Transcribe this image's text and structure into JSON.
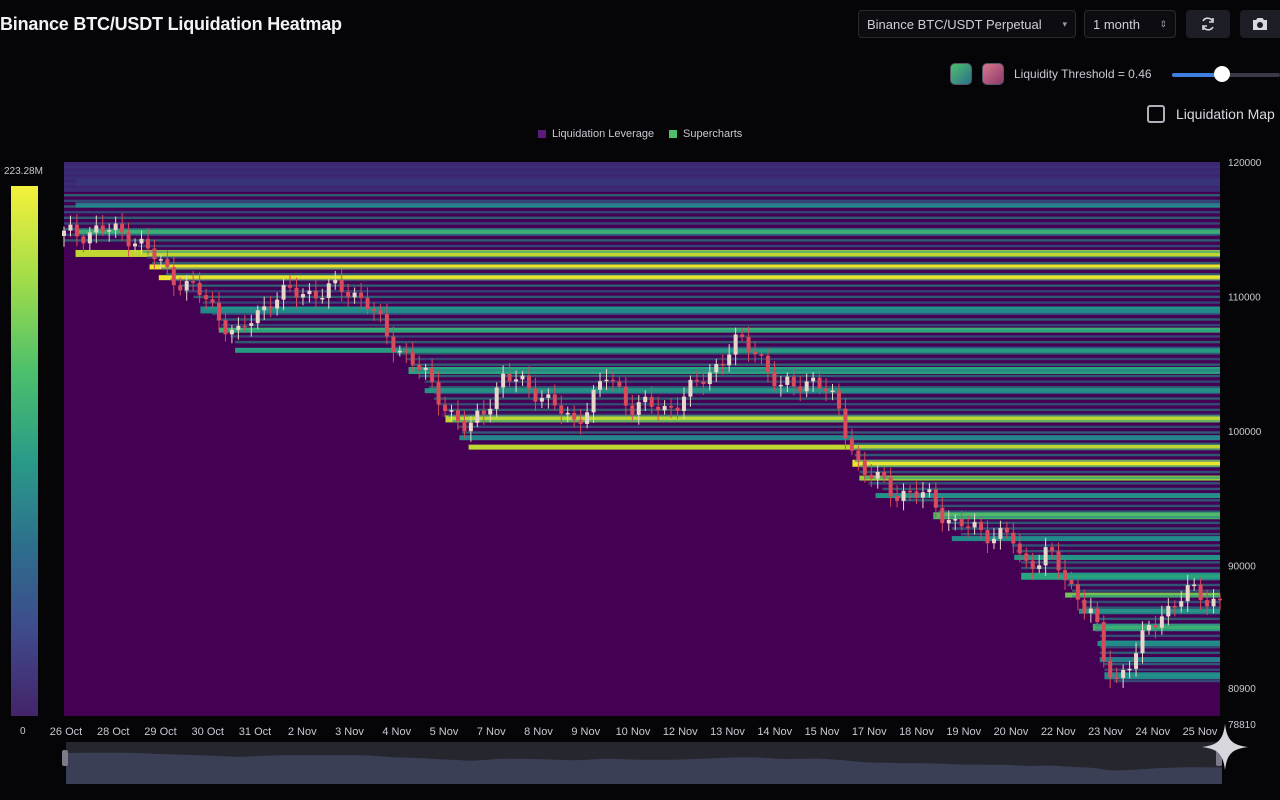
{
  "header": {
    "title": "Binance BTC/USDT Liquidation Heatmap",
    "pair_select": "Binance BTC/USDT Perpetual",
    "timeframe_select": "1 month",
    "refresh_icon": "refresh-icon",
    "camera_icon": "camera-icon"
  },
  "controls": {
    "threshold_label": "Liquidity Threshold = 0.46",
    "threshold_value": 0.46,
    "swatch_green": "#4cc06c",
    "swatch_pink": "#d9788e",
    "liquidation_map_label": "Liquidation Map",
    "liquidation_map_checked": false
  },
  "colors": {
    "background": "#050508",
    "heatmap_base": "#440154",
    "accent_blue": "#3d7ee0",
    "candle_up": "#e8d7c8",
    "candle_down": "#d94a5a"
  },
  "colorbar": {
    "max_label": "223.28M",
    "min_label": "0"
  },
  "chart_data": {
    "type": "heatmap",
    "title": "",
    "legend": [
      {
        "name": "Liquidation Leverage",
        "color": "#5a1b7a"
      },
      {
        "name": "Supercharts",
        "color": "#4cc06c"
      }
    ],
    "legend_position": "top-center",
    "y_axis": {
      "ticks": [
        "120000",
        "110000",
        "100000",
        "90000",
        "80900",
        "78810"
      ],
      "range": [
        78810,
        120000
      ]
    },
    "x_axis": {
      "ticks": [
        "26 Oct",
        "28 Oct",
        "29 Oct",
        "30 Oct",
        "31 Oct",
        "2 Nov",
        "3 Nov",
        "4 Nov",
        "5 Nov",
        "7 Nov",
        "8 Nov",
        "9 Nov",
        "10 Nov",
        "12 Nov",
        "13 Nov",
        "14 Nov",
        "15 Nov",
        "17 Nov",
        "18 Nov",
        "19 Nov",
        "20 Nov",
        "22 Nov",
        "23 Nov",
        "24 Nov",
        "25 Nov"
      ]
    },
    "price_path": [
      [
        0,
        114500
      ],
      [
        0.03,
        115000
      ],
      [
        0.06,
        114500
      ],
      [
        0.09,
        111800
      ],
      [
        0.12,
        110000
      ],
      [
        0.15,
        107000
      ],
      [
        0.18,
        110000
      ],
      [
        0.21,
        110300
      ],
      [
        0.24,
        110500
      ],
      [
        0.26,
        110000
      ],
      [
        0.28,
        106800
      ],
      [
        0.3,
        105500
      ],
      [
        0.32,
        103000
      ],
      [
        0.35,
        99800
      ],
      [
        0.38,
        104000
      ],
      [
        0.41,
        103000
      ],
      [
        0.44,
        100500
      ],
      [
        0.47,
        104000
      ],
      [
        0.49,
        102000
      ],
      [
        0.52,
        101600
      ],
      [
        0.55,
        103500
      ],
      [
        0.58,
        106500
      ],
      [
        0.6,
        106000
      ],
      [
        0.62,
        103000
      ],
      [
        0.65,
        104000
      ],
      [
        0.67,
        101500
      ],
      [
        0.69,
        97000
      ],
      [
        0.72,
        95500
      ],
      [
        0.75,
        95000
      ],
      [
        0.77,
        93000
      ],
      [
        0.8,
        92500
      ],
      [
        0.82,
        92000
      ],
      [
        0.83,
        90000
      ],
      [
        0.85,
        91000
      ],
      [
        0.87,
        88500
      ],
      [
        0.89,
        86500
      ],
      [
        0.9,
        82500
      ],
      [
        0.91,
        81500
      ],
      [
        0.93,
        84000
      ],
      [
        0.95,
        86500
      ],
      [
        0.97,
        88000
      ],
      [
        0.99,
        87500
      ],
      [
        1.0,
        87500
      ]
    ],
    "bands": [
      {
        "price": 118500,
        "intensity": 0.55
      },
      {
        "price": 116800,
        "intensity": 0.45
      },
      {
        "price": 114800,
        "intensity": 0.75
      },
      {
        "price": 113200,
        "intensity": 0.95
      },
      {
        "price": 112200,
        "intensity": 1.0
      },
      {
        "price": 111400,
        "intensity": 1.0
      },
      {
        "price": 109000,
        "intensity": 0.55
      },
      {
        "price": 107500,
        "intensity": 0.75
      },
      {
        "price": 106000,
        "intensity": 0.65
      },
      {
        "price": 104500,
        "intensity": 0.7
      },
      {
        "price": 103000,
        "intensity": 0.6
      },
      {
        "price": 101200,
        "intensity": 0.05
      },
      {
        "price": 100900,
        "intensity": 0.95
      },
      {
        "price": 99500,
        "intensity": 0.55
      },
      {
        "price": 98800,
        "intensity": 0.95
      },
      {
        "price": 97600,
        "intensity": 1.0
      },
      {
        "price": 96500,
        "intensity": 0.9
      },
      {
        "price": 95200,
        "intensity": 0.6
      },
      {
        "price": 93700,
        "intensity": 0.8
      },
      {
        "price": 92000,
        "intensity": 0.55
      },
      {
        "price": 90600,
        "intensity": 0.65
      },
      {
        "price": 89200,
        "intensity": 0.7
      },
      {
        "price": 87800,
        "intensity": 0.85
      },
      {
        "price": 86600,
        "intensity": 0.6
      },
      {
        "price": 85400,
        "intensity": 0.75
      },
      {
        "price": 84200,
        "intensity": 0.55
      },
      {
        "price": 83000,
        "intensity": 0.5
      },
      {
        "price": 81800,
        "intensity": 0.55
      }
    ]
  }
}
